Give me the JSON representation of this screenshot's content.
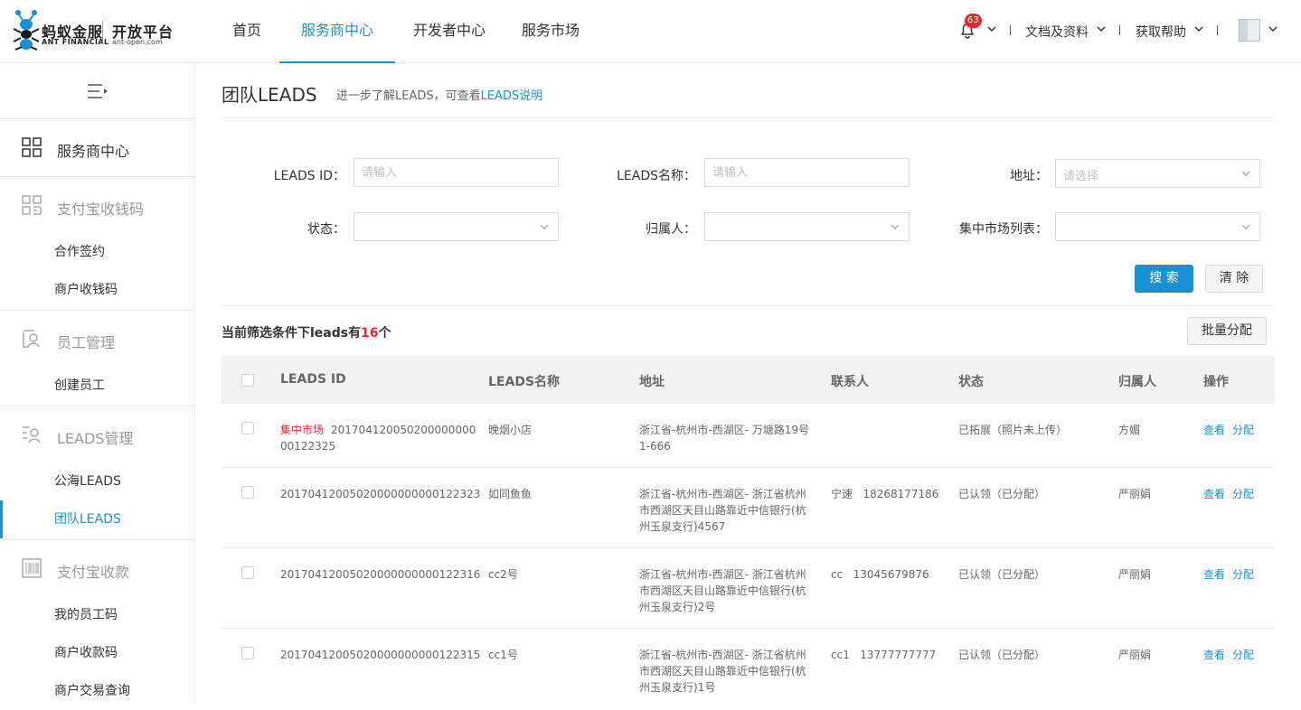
{
  "header": {
    "logo": {
      "cn": "蚂蚁金服",
      "en": "ANT FINANCIAL",
      "platform": "开放平台",
      "url": "ant-open.com"
    },
    "nav": [
      {
        "label": "首页",
        "active": false
      },
      {
        "label": "服务商中心",
        "active": true
      },
      {
        "label": "开发者中心",
        "active": false
      },
      {
        "label": "服务市场",
        "active": false
      }
    ],
    "notification_count": "63",
    "docs_label": "文档及资料",
    "help_label": "获取帮助"
  },
  "sidebar": {
    "groups": [
      {
        "label": "服务商中心",
        "icon": "grid-icon",
        "strong": true,
        "items": []
      },
      {
        "label": "支付宝收钱码",
        "icon": "qr-grid-icon",
        "items": [
          "合作签约",
          "商户收钱码"
        ]
      },
      {
        "label": "员工管理",
        "icon": "staff-icon",
        "items": [
          "创建员工"
        ]
      },
      {
        "label": "LEADS管理",
        "icon": "leads-icon",
        "items": [
          "公海LEADS",
          "团队LEADS"
        ]
      },
      {
        "label": "支付宝收款",
        "icon": "barcode-icon",
        "items": [
          "我的员工码",
          "商户收款码",
          "商户交易查询"
        ]
      }
    ],
    "active_item": "团队LEADS"
  },
  "page": {
    "title": "团队LEADS",
    "desc_prefix": "进一步了解LEADS，可查看",
    "desc_link": "LEADS说明"
  },
  "filters": {
    "leads_id": {
      "label": "LEADS ID：",
      "placeholder": "请输入",
      "value": ""
    },
    "leads_name": {
      "label": "LEADS名称：",
      "placeholder": "请输入",
      "value": ""
    },
    "address": {
      "label": "地址：",
      "placeholder": "请选择"
    },
    "status": {
      "label": "状态：",
      "value": ""
    },
    "owner": {
      "label": "归属人：",
      "value": ""
    },
    "market_list": {
      "label": "集中市场列表：",
      "value": ""
    },
    "search_label": "搜 索",
    "clear_label": "清 除"
  },
  "summary": {
    "prefix": "当前筛选条件下leads有",
    "count": "16",
    "suffix": "个",
    "batch_label": "批量分配"
  },
  "table": {
    "columns": [
      "LEADS ID",
      "LEADS名称",
      "地址",
      "联系人",
      "状态",
      "归属人",
      "操作"
    ],
    "rows": [
      {
        "tag": "集中市场",
        "id": "20170412005020000000000122325",
        "name": "晚烟小店",
        "address": "浙江省-杭州市-西湖区- 万塘路19号1-666",
        "contact": "",
        "status": "已拓展（照片未上传）",
        "owner": "方媚"
      },
      {
        "tag": "",
        "id": "20170412005020000000000122323",
        "name": "如同鱼鱼",
        "address": "浙江省-杭州市-西湖区- 浙江省杭州市西湖区天目山路靠近中信银行(杭州玉泉支行)4567",
        "contact": "宁速   18268177186",
        "status": "已认领（已分配）",
        "owner": "严丽娟"
      },
      {
        "tag": "",
        "id": "20170412005020000000000122316",
        "name": "cc2号",
        "address": "浙江省-杭州市-西湖区- 浙江省杭州市西湖区天目山路靠近中信银行(杭州玉泉支行)2号",
        "contact": "cc   13045679876",
        "status": "已认领（已分配）",
        "owner": "严丽娟"
      },
      {
        "tag": "",
        "id": "20170412005020000000000122315",
        "name": "cc1号",
        "address": "浙江省-杭州市-西湖区- 浙江省杭州市西湖区天目山路靠近中信银行(杭州玉泉支行)1号",
        "contact": "cc1   13777777777",
        "status": "已认领（已分配）",
        "owner": "严丽娟"
      }
    ],
    "actions": {
      "view": "查看",
      "assign": "分配"
    }
  },
  "colors": {
    "accent": "#1890d4",
    "danger": "#f5222d"
  }
}
